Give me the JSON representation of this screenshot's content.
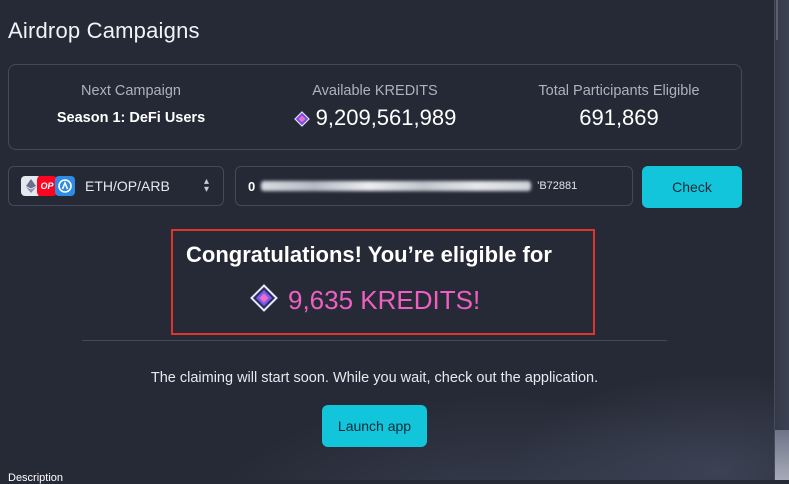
{
  "page": {
    "title": "Airdrop Campaigns"
  },
  "stats": {
    "next_campaign": {
      "label": "Next Campaign",
      "value": "Season 1: DeFi Users"
    },
    "available": {
      "label": "Available KREDITS",
      "value": "9,209,561,989",
      "icon": "kredits-gem-icon"
    },
    "participants": {
      "label": "Total Participants Eligible",
      "value": "691,869"
    }
  },
  "chain_select": {
    "value": "ETH/OP/ARB",
    "icons": [
      "ethereum-icon",
      "optimism-icon",
      "arbitrum-icon"
    ],
    "op_chip_text": "OP"
  },
  "address_input": {
    "visible_start": "0",
    "visible_end": "'B72881"
  },
  "check_button": {
    "label": "Check"
  },
  "result": {
    "headline": "Congratulations! You’re eligible for",
    "amount": "9,635 KREDITS!"
  },
  "claim": {
    "note": "The claiming will start soon. While you wait, check out the application.",
    "launch_label": "Launch app"
  },
  "footer": {
    "description_label": "Description"
  },
  "colors": {
    "background": "#262a36",
    "accent": "#13c5da",
    "reward": "#ef5fc3",
    "highlight_border": "#e0332c"
  }
}
